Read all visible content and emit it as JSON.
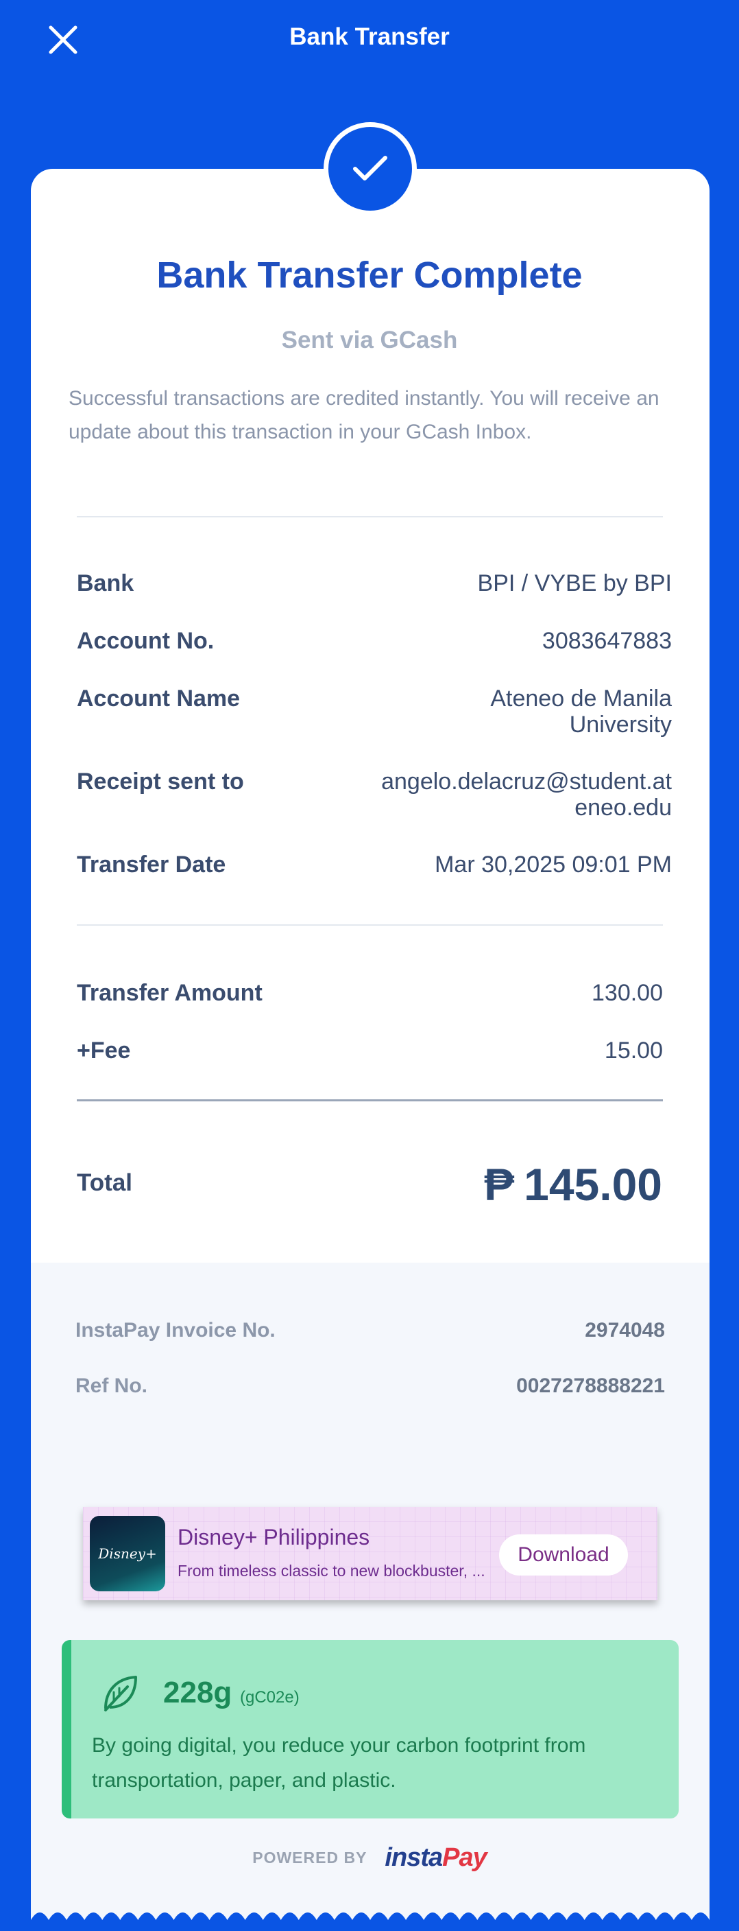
{
  "header": {
    "title": "Bank Transfer",
    "close_icon": "close-icon"
  },
  "status": {
    "icon": "checkmark-icon",
    "title": "Bank Transfer Complete",
    "subtitle": "Sent via GCash",
    "message": "Successful transactions are credited instantly. You will receive an update about this transaction in your GCash Inbox."
  },
  "details": [
    {
      "label": "Bank",
      "value": "BPI / VYBE by BPI"
    },
    {
      "label": "Account No.",
      "value": "3083647883"
    },
    {
      "label": "Account Name",
      "value": "Ateneo de Manila University"
    },
    {
      "label": "Receipt sent to",
      "value": "angelo.delacruz@student.ateneo.edu"
    },
    {
      "label": "Transfer Date",
      "value": "Mar 30,2025 09:01 PM"
    }
  ],
  "amounts": [
    {
      "label": "Transfer Amount",
      "value": "130.00"
    },
    {
      "label": "+Fee",
      "value": "15.00"
    }
  ],
  "total": {
    "label": "Total",
    "currency_symbol": "₱",
    "value": "145.00"
  },
  "meta": [
    {
      "label": "InstaPay Invoice No.",
      "value": "2974048"
    },
    {
      "label": "Ref No.",
      "value": "0027278888221"
    }
  ],
  "ad": {
    "logo_text": "Disney+",
    "title": "Disney+ Philippines",
    "description": "From timeless classic to new blockbuster, ...",
    "button": "Download"
  },
  "eco": {
    "icon": "leaf-icon",
    "amount": "228g",
    "unit": "(gC02e)",
    "message": "By going digital, you reduce your carbon footprint from transportation, paper, and plastic."
  },
  "footer": {
    "powered_label": "POWERED BY",
    "brand_insta": "insta",
    "brand_pay": "Pay"
  },
  "colors": {
    "primary": "#0A55E4",
    "title": "#1F4FBF",
    "eco_bg": "#9EE8C6",
    "eco_accent": "#2DBE7A"
  }
}
